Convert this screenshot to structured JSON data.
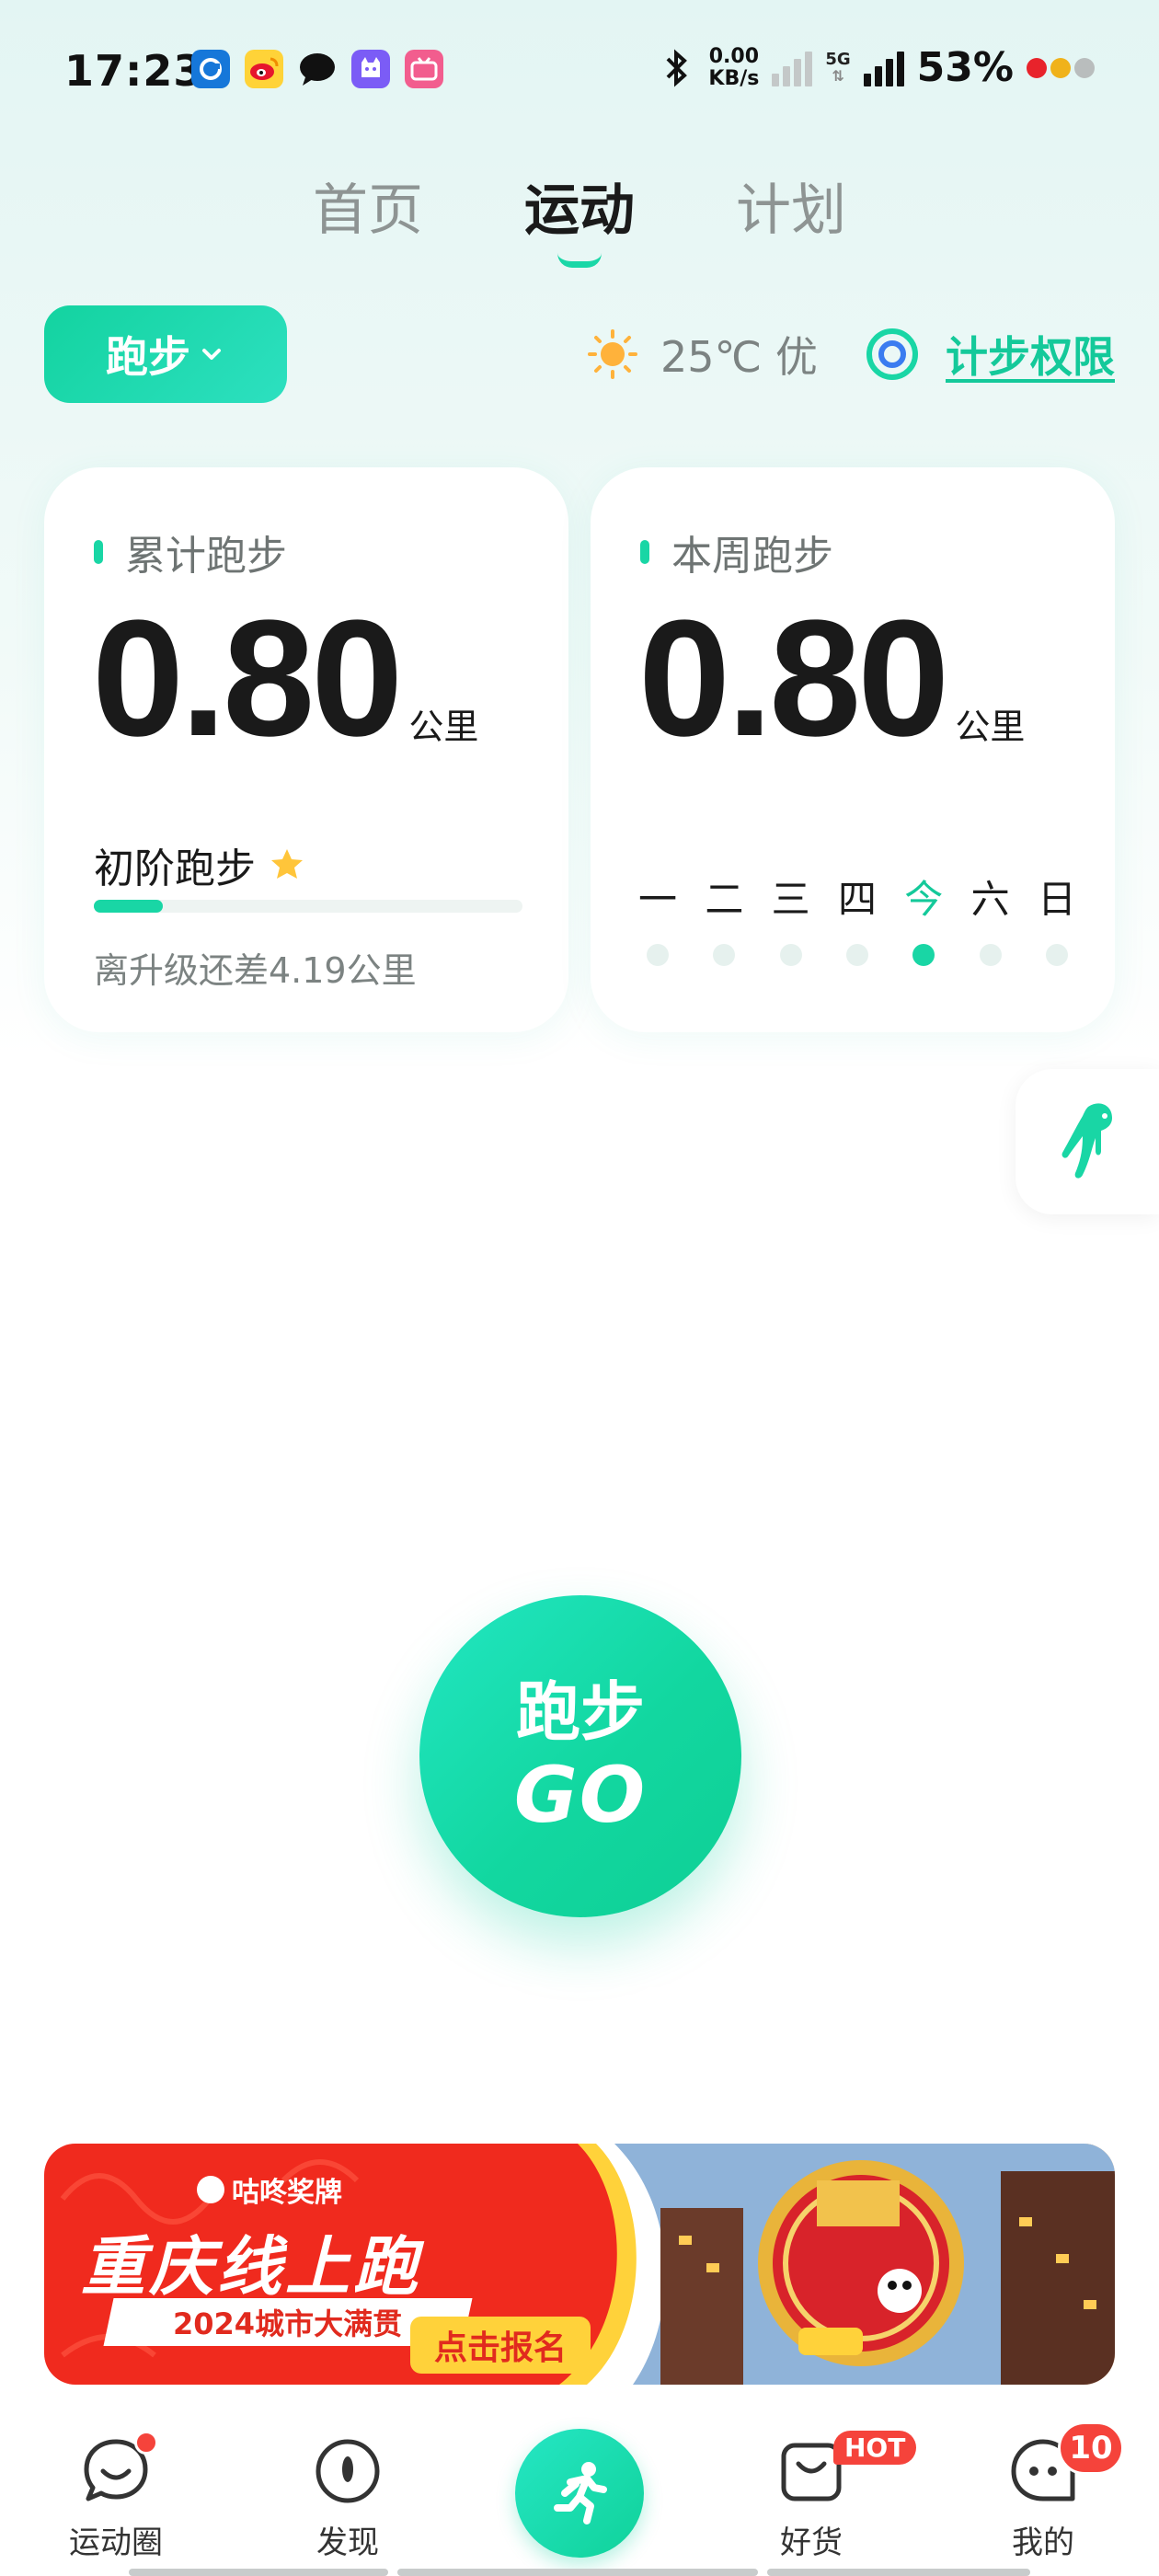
{
  "status_bar": {
    "time": "17:23",
    "net_speed_value": "0.00",
    "net_speed_unit": "KB/s",
    "network_type": "5G",
    "battery": "53%"
  },
  "top_tabs": [
    {
      "label": "首页",
      "active": false
    },
    {
      "label": "运动",
      "active": true
    },
    {
      "label": "计划",
      "active": false
    }
  ],
  "sport_selector": {
    "label": "跑步",
    "icon": "chevron-down-icon"
  },
  "weather": {
    "text": "25℃ 优",
    "icon": "sun-icon"
  },
  "step_permission": {
    "label": "计步权限",
    "icon": "ring-icon"
  },
  "cumulative_card": {
    "title": "累计跑步",
    "value": "0.80",
    "unit": "公里",
    "level": "初阶跑步",
    "level_icon": "star-icon",
    "progress": 0.16,
    "hint": "离升级还差4.19公里"
  },
  "weekly_card": {
    "title": "本周跑步",
    "value": "0.80",
    "unit": "公里",
    "days": [
      "一",
      "二",
      "三",
      "四",
      "今",
      "六",
      "日"
    ],
    "today_index": 4,
    "active_days": [
      4
    ]
  },
  "go_button": {
    "label": "跑步",
    "sub": "GO"
  },
  "banner": {
    "brand": "咕咚奖牌",
    "title": "重庆线上跑",
    "subtitle": "2024城市大满贯",
    "cta": "点击报名"
  },
  "bottom_nav": {
    "items": [
      {
        "label": "运动圈",
        "icon": "chat-face-icon"
      },
      {
        "label": "发现",
        "icon": "compass-icon"
      },
      {
        "label": "",
        "icon": "runner-icon"
      },
      {
        "label": "好货",
        "icon": "shopping-bag-icon",
        "badge": "HOT"
      },
      {
        "label": "我的",
        "icon": "profile-face-icon",
        "badge": "10"
      }
    ]
  },
  "colors": {
    "accent": "#19d6a5",
    "badge": "#f5433b",
    "banner_red": "#f02a1e",
    "banner_yellow": "#ffd23a"
  }
}
